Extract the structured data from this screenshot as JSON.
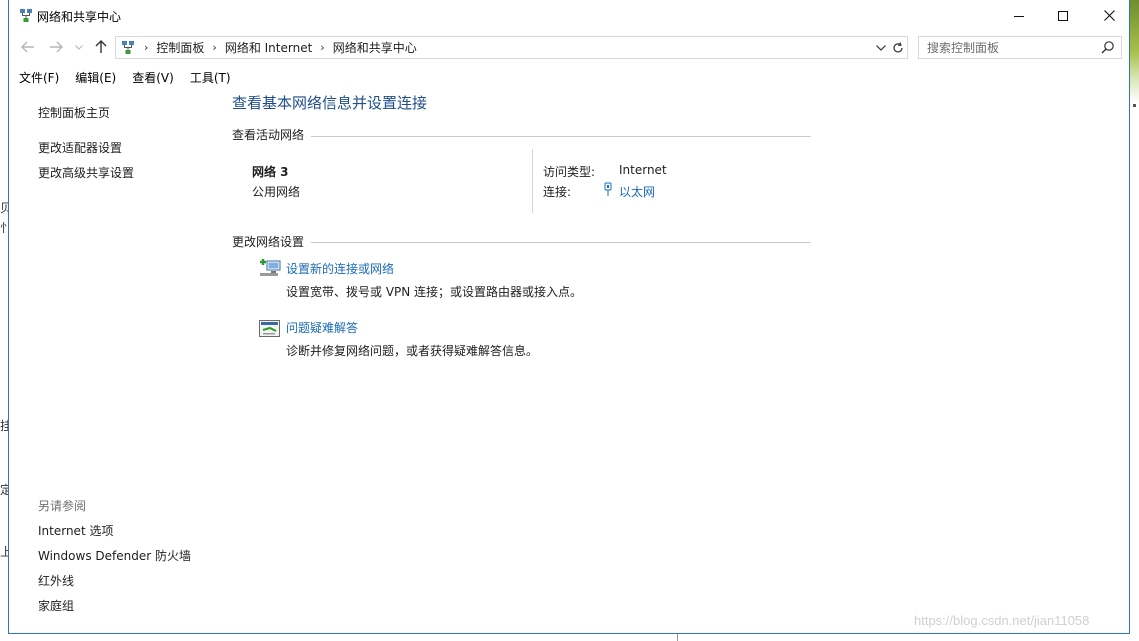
{
  "window": {
    "title": "网络和共享中心"
  },
  "address": {
    "crumbs": [
      "控制面板",
      "网络和 Internet",
      "网络和共享中心"
    ]
  },
  "search": {
    "placeholder": "搜索控制面板"
  },
  "menu": {
    "items": [
      "文件(F)",
      "编辑(E)",
      "查看(V)",
      "工具(T)"
    ]
  },
  "sidebar": {
    "links": [
      "控制面板主页",
      "更改适配器设置",
      "更改高级共享设置"
    ],
    "see_also_heading": "另请参阅",
    "see_also": [
      "Internet 选项",
      "Windows Defender 防火墙",
      "红外线",
      "家庭组"
    ]
  },
  "main": {
    "title": "查看基本网络信息并设置连接",
    "active_networks_label": "查看活动网络",
    "network": {
      "name": "网络  3",
      "type": "公用网络",
      "access_label": "访问类型:",
      "access_value": "Internet",
      "connection_label": "连接:",
      "connection_value": "以太网"
    },
    "change_settings_label": "更改网络设置",
    "tasks": [
      {
        "title": "设置新的连接或网络",
        "desc": "设置宽带、拨号或 VPN 连接；或设置路由器或接入点。"
      },
      {
        "title": "问题疑难解答",
        "desc": "诊断并修复网络问题，或者获得疑难解答信息。"
      }
    ]
  },
  "desktop": {
    "left_glyphs": [
      "贝",
      "忄",
      "挂",
      "定",
      "上"
    ]
  },
  "watermark": "https://blog.csdn.net/jian11058"
}
